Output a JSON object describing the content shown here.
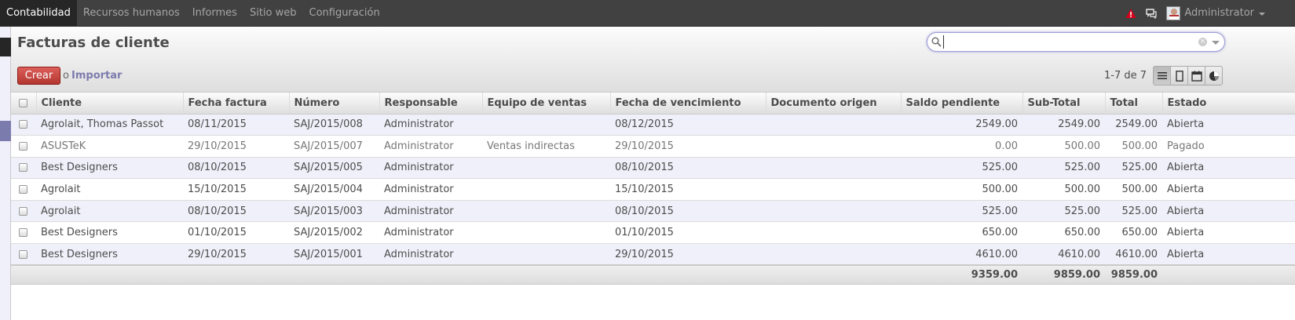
{
  "topmenu": {
    "items": [
      {
        "label": "Contabilidad",
        "active": true
      },
      {
        "label": "Recursos humanos"
      },
      {
        "label": "Informes"
      },
      {
        "label": "Sitio web"
      },
      {
        "label": "Configuración"
      }
    ],
    "user": "Administrator"
  },
  "page": {
    "title": "Facturas de cliente",
    "create_label": "Crear",
    "or_label": "o",
    "import_label": "Importar",
    "pager": "1-7 de 7",
    "search_value": ""
  },
  "views": [
    "list-icon",
    "form-icon",
    "calendar-icon",
    "graph-icon"
  ],
  "colors": {
    "accent": "#7c7bad",
    "create": "#c9302c",
    "topbar": "#414141",
    "warning": "#d9001b"
  },
  "table": {
    "columns": [
      "Cliente",
      "Fecha factura",
      "Número",
      "Responsable",
      "Equipo de ventas",
      "Fecha de vencimiento",
      "Documento origen",
      "Saldo pendiente",
      "Sub-Total",
      "Total",
      "Estado"
    ],
    "rows": [
      {
        "cliente": "Agrolait, Thomas Passot",
        "fecha": "08/11/2015",
        "numero": "SAJ/2015/008",
        "responsable": "Administrator",
        "equipo": "",
        "vencimiento": "08/12/2015",
        "origen": "",
        "saldo": "2549.00",
        "subtotal": "2549.00",
        "total": "2549.00",
        "estado": "Abierta"
      },
      {
        "cliente": "ASUSTeK",
        "fecha": "29/10/2015",
        "numero": "SAJ/2015/007",
        "responsable": "Administrator",
        "equipo": "Ventas indirectas",
        "vencimiento": "29/10/2015",
        "origen": "",
        "saldo": "0.00",
        "subtotal": "500.00",
        "total": "500.00",
        "estado": "Pagado"
      },
      {
        "cliente": "Best Designers",
        "fecha": "08/10/2015",
        "numero": "SAJ/2015/005",
        "responsable": "Administrator",
        "equipo": "",
        "vencimiento": "08/10/2015",
        "origen": "",
        "saldo": "525.00",
        "subtotal": "525.00",
        "total": "525.00",
        "estado": "Abierta"
      },
      {
        "cliente": "Agrolait",
        "fecha": "15/10/2015",
        "numero": "SAJ/2015/004",
        "responsable": "Administrator",
        "equipo": "",
        "vencimiento": "15/10/2015",
        "origen": "",
        "saldo": "500.00",
        "subtotal": "500.00",
        "total": "500.00",
        "estado": "Abierta"
      },
      {
        "cliente": "Agrolait",
        "fecha": "08/10/2015",
        "numero": "SAJ/2015/003",
        "responsable": "Administrator",
        "equipo": "",
        "vencimiento": "08/10/2015",
        "origen": "",
        "saldo": "525.00",
        "subtotal": "525.00",
        "total": "525.00",
        "estado": "Abierta"
      },
      {
        "cliente": "Best Designers",
        "fecha": "01/10/2015",
        "numero": "SAJ/2015/002",
        "responsable": "Administrator",
        "equipo": "",
        "vencimiento": "01/10/2015",
        "origen": "",
        "saldo": "650.00",
        "subtotal": "650.00",
        "total": "650.00",
        "estado": "Abierta"
      },
      {
        "cliente": "Best Designers",
        "fecha": "29/10/2015",
        "numero": "SAJ/2015/001",
        "responsable": "Administrator",
        "equipo": "",
        "vencimiento": "29/10/2015",
        "origen": "",
        "saldo": "4610.00",
        "subtotal": "4610.00",
        "total": "4610.00",
        "estado": "Abierta"
      }
    ],
    "totals": {
      "saldo": "9359.00",
      "subtotal": "9859.00",
      "total": "9859.00"
    }
  }
}
